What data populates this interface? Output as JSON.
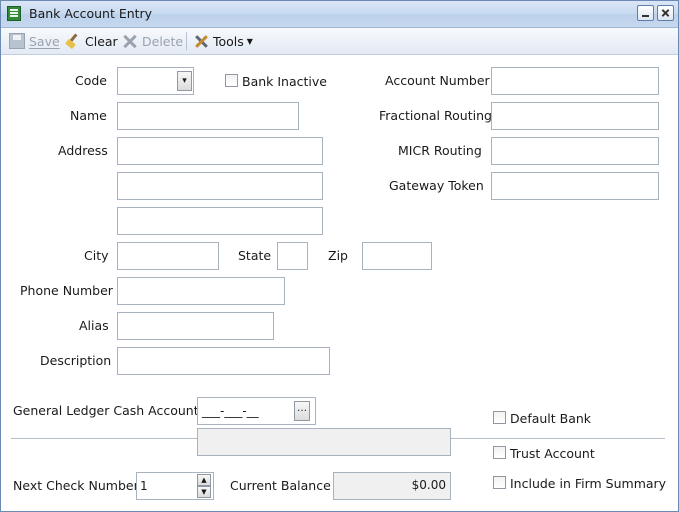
{
  "window": {
    "title": "Bank Account Entry"
  },
  "toolbar": {
    "save_label": "Save",
    "clear_label": "Clear",
    "delete_label": "Delete",
    "tools_label": "Tools"
  },
  "form": {
    "code_label": "Code",
    "code_value": "",
    "bank_inactive_label": "Bank Inactive",
    "bank_inactive_checked": false,
    "name_label": "Name",
    "name_value": "",
    "address_label": "Address",
    "address1_value": "",
    "address2_value": "",
    "address3_value": "",
    "city_label": "City",
    "city_value": "",
    "state_label": "State",
    "state_value": "",
    "zip_label": "Zip",
    "zip_value": "",
    "phone_label": "Phone Number",
    "phone_value": "",
    "alias_label": "Alias",
    "alias_value": "",
    "description_label": "Description",
    "description_value": "",
    "account_number_label": "Account Number",
    "account_number_value": "",
    "fractional_routing_label": "Fractional Routing",
    "fractional_routing_value": "",
    "micr_routing_label": "MICR Routing",
    "micr_routing_value": "",
    "gateway_token_label": "Gateway Token",
    "gateway_token_value": ""
  },
  "ledger": {
    "gl_cash_account_label": "General Ledger Cash Account",
    "gl_cash_account_value": "___-___-__",
    "gl_description_value": "",
    "default_bank_label": "Default Bank",
    "default_bank_checked": false,
    "trust_account_label": "Trust Account",
    "trust_account_checked": false,
    "include_firm_summary_label": "Include in Firm Summary",
    "include_firm_summary_checked": false,
    "next_check_number_label": "Next Check Number",
    "next_check_number_value": "1",
    "current_balance_label": "Current Balance",
    "current_balance_value": "$0.00"
  },
  "icons": {
    "app": "ledger-icon",
    "save": "save-icon",
    "clear": "broom-icon",
    "delete": "x-icon",
    "tools": "tools-icon"
  }
}
